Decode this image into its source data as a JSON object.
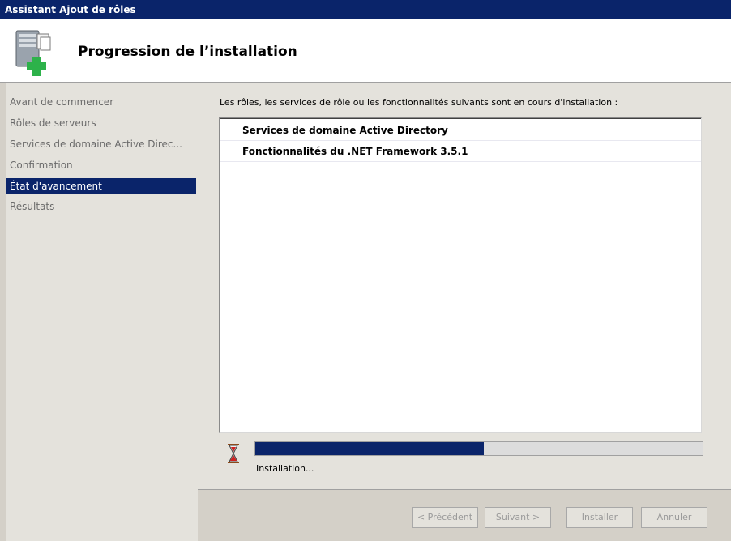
{
  "window": {
    "title": "Assistant Ajout de rôles"
  },
  "header": {
    "title": "Progression de l’installation",
    "icon": "server-add-icon"
  },
  "sidebar": {
    "items": [
      {
        "label": "Avant de commencer",
        "active": false
      },
      {
        "label": "Rôles de serveurs",
        "active": false
      },
      {
        "label": "Services de domaine Active Direc...",
        "active": false
      },
      {
        "label": "Confirmation",
        "active": false
      },
      {
        "label": "État d'avancement",
        "active": true
      },
      {
        "label": "Résultats",
        "active": false
      }
    ]
  },
  "main": {
    "intro": "Les rôles, les services de rôle ou les fonctionnalités suivants sont en cours d'installation :",
    "list": [
      "Services de domaine Active Directory",
      "Fonctionnalités du .NET Framework 3.5.1"
    ],
    "progress": {
      "value": 0.51,
      "label": "Installation...",
      "icon": "hourglass-icon"
    }
  },
  "footer": {
    "previous_label": "< Précédent",
    "next_label": "Suivant >",
    "install_label": "Installer",
    "cancel_label": "Annuler"
  },
  "colors": {
    "accent": "#0a246a",
    "background": "#d4d0c8",
    "panel": "#e4e2dc"
  }
}
